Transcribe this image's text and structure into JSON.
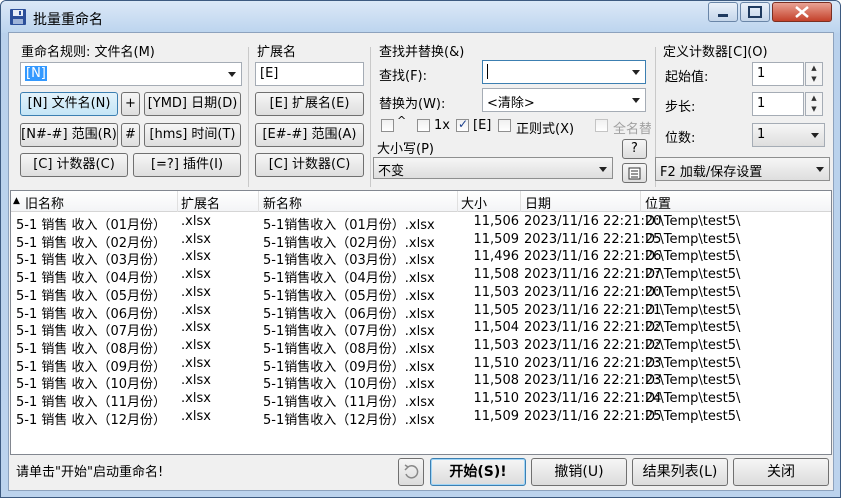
{
  "window": {
    "title": "批量重命名"
  },
  "panel_rename": {
    "label": "重命名规则: 文件名(M)",
    "pattern_value": "[N]",
    "buttons": {
      "filename": "[N] 文件名(N)",
      "plus": "+",
      "date": "[YMD] 日期(D)",
      "range": "[N#-#] 范围(R)",
      "hash": "#",
      "time": "[hms] 时间(T)",
      "counter": "[C] 计数器(C)",
      "plugin": "[=?] 插件(I)"
    }
  },
  "panel_ext": {
    "label": "扩展名",
    "value": "[E]",
    "buttons": {
      "ext": "[E] 扩展名(E)",
      "range": "[E#-#] 范围(A)",
      "counter": "[C] 计数器(C)"
    }
  },
  "panel_find": {
    "label": "查找并替换(&)",
    "find_label": "查找(F):",
    "find_value": "",
    "replace_label": "替换为(W):",
    "replace_value": "<清除>",
    "opt_case": "^",
    "opt_once": "1x",
    "opt_ext": "[E]",
    "opt_regex": "正则式(X)",
    "opt_fullname": "全名替",
    "case_label": "大小写(P)",
    "case_value": "不变",
    "help_button": "?"
  },
  "panel_counter": {
    "label": "定义计数器[C](O)",
    "start_label": "起始值:",
    "start_value": "1",
    "step_label": "步长:",
    "step_value": "1",
    "digits_label": "位数:",
    "digits_value": "1",
    "load_save": "F2 加载/保存设置"
  },
  "list": {
    "columns": [
      "旧名称",
      "扩展名",
      "新名称",
      "大小",
      "日期",
      "位置"
    ],
    "rows": [
      {
        "old": "5-1  销售 收入（01月份）",
        "ext": ".xlsx",
        "new": "5-1销售收入（01月份）.xlsx",
        "size": "11,506",
        "date": "2023/11/16 22:21:20",
        "path": "D:\\Temp\\test5\\"
      },
      {
        "old": "5-1  销售 收入（02月份）",
        "ext": ".xlsx",
        "new": "5-1销售收入（02月份）.xlsx",
        "size": "11,509",
        "date": "2023/11/16 22:21:25",
        "path": "D:\\Temp\\test5\\"
      },
      {
        "old": "5-1  销售 收入（03月份）",
        "ext": ".xlsx",
        "new": "5-1销售收入（03月份）.xlsx",
        "size": "11,496",
        "date": "2023/11/16 22:21:26",
        "path": "D:\\Temp\\test5\\"
      },
      {
        "old": "5-1  销售 收入（04月份）",
        "ext": ".xlsx",
        "new": "5-1销售收入（04月份）.xlsx",
        "size": "11,508",
        "date": "2023/11/16 22:21:27",
        "path": "D:\\Temp\\test5\\"
      },
      {
        "old": "5-1  销售 收入（05月份）",
        "ext": ".xlsx",
        "new": "5-1销售收入（05月份）.xlsx",
        "size": "11,503",
        "date": "2023/11/16 22:21:20",
        "path": "D:\\Temp\\test5\\"
      },
      {
        "old": "5-1  销售 收入（06月份）",
        "ext": ".xlsx",
        "new": "5-1销售收入（06月份）.xlsx",
        "size": "11,505",
        "date": "2023/11/16 22:21:21",
        "path": "D:\\Temp\\test5\\"
      },
      {
        "old": "5-1  销售 收入（07月份）",
        "ext": ".xlsx",
        "new": "5-1销售收入（07月份）.xlsx",
        "size": "11,504",
        "date": "2023/11/16 22:21:22",
        "path": "D:\\Temp\\test5\\"
      },
      {
        "old": "5-1  销售 收入（08月份）",
        "ext": ".xlsx",
        "new": "5-1销售收入（08月份）.xlsx",
        "size": "11,503",
        "date": "2023/11/16 22:21:22",
        "path": "D:\\Temp\\test5\\"
      },
      {
        "old": "5-1  销售 收入（09月份）",
        "ext": ".xlsx",
        "new": "5-1销售收入（09月份）.xlsx",
        "size": "11,510",
        "date": "2023/11/16 22:21:23",
        "path": "D:\\Temp\\test5\\"
      },
      {
        "old": "5-1  销售 收入（10月份）",
        "ext": ".xlsx",
        "new": "5-1销售收入（10月份）.xlsx",
        "size": "11,508",
        "date": "2023/11/16 22:21:23",
        "path": "D:\\Temp\\test5\\"
      },
      {
        "old": "5-1  销售 收入（11月份）",
        "ext": ".xlsx",
        "new": "5-1销售收入（11月份）.xlsx",
        "size": "11,510",
        "date": "2023/11/16 22:21:24",
        "path": "D:\\Temp\\test5\\"
      },
      {
        "old": "5-1  销售 收入（12月份）",
        "ext": ".xlsx",
        "new": "5-1销售收入（12月份）.xlsx",
        "size": "11,509",
        "date": "2023/11/16 22:21:25",
        "path": "D:\\Temp\\test5\\"
      }
    ]
  },
  "footer": {
    "status": "请单击\"开始\"启动重命名!",
    "start": "开始(S)!",
    "undo": "撤销(U)",
    "result_list": "结果列表(L)",
    "close": "关闭"
  },
  "colors": {
    "accent": "#3c7fb1",
    "title_bg": "#c7dcf3"
  }
}
